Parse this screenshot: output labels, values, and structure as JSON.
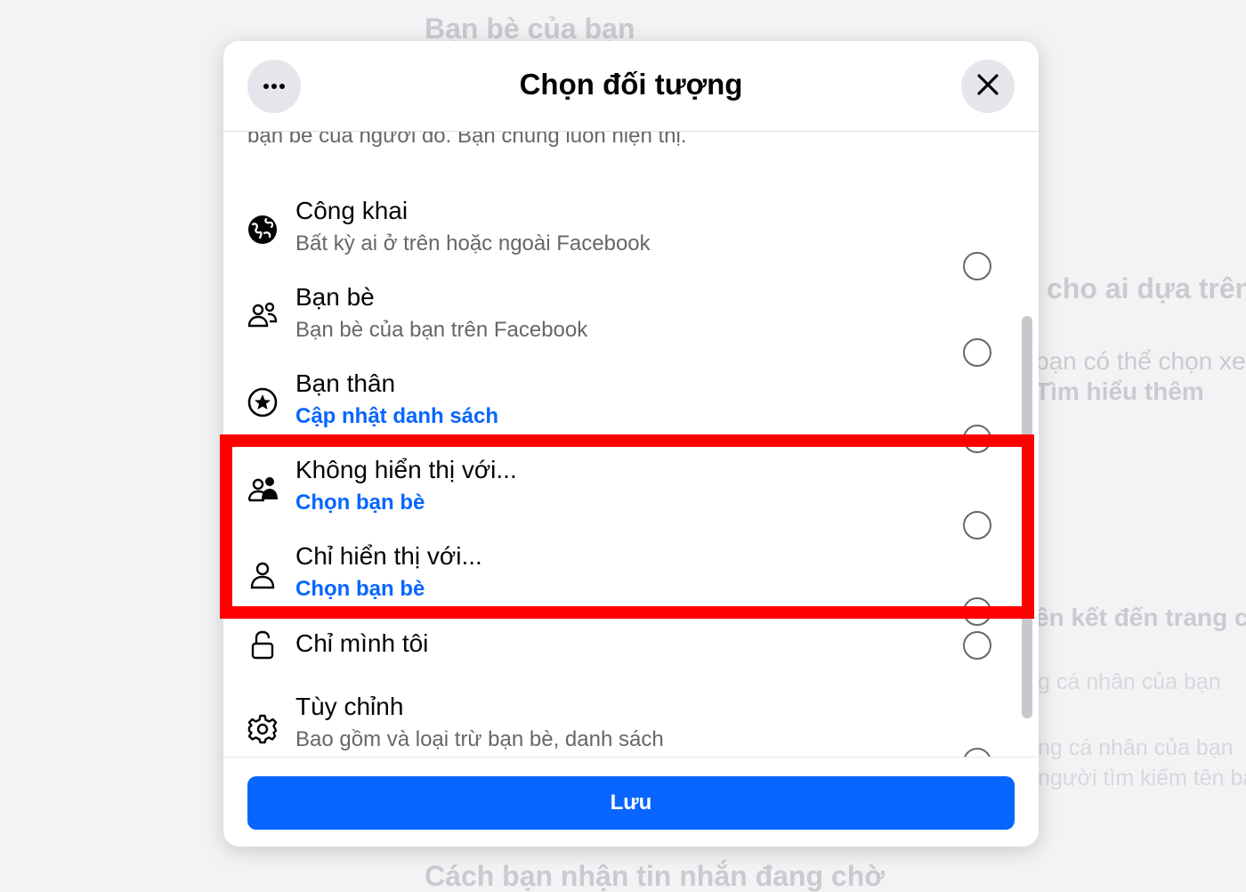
{
  "background": {
    "heading_top": "Bạn bè của bạn",
    "right_heading": "cho ai dựa trên",
    "right_text_1": "bạn có thể chọn xe",
    "right_link": "Tìm hiểu thêm",
    "right_heading_2": "ên kết đến trang cá",
    "right_text_2": "g cá nhân của bạn",
    "right_text_3": "ng cá nhân của bạn",
    "right_text_4": "người tìm kiếm tên ba",
    "heading_bottom": "Cách bạn nhận tin nhắn đang chờ"
  },
  "dialog": {
    "title": "Chọn đối tượng",
    "more_icon": "more-horizontal-icon",
    "close_icon": "close-icon",
    "clipped_description": "bạn bè của người đó. Bạn chúng luôn hiện thị.",
    "options": [
      {
        "title": "Công khai",
        "subtitle": "Bất kỳ ai ở trên hoặc ngoài Facebook",
        "icon": "globe-icon",
        "selected": false
      },
      {
        "title": "Bạn bè",
        "subtitle": "Bạn bè của bạn trên Facebook",
        "icon": "friends-icon",
        "selected": false
      },
      {
        "title": "Bạn thân",
        "subtitle": "Cập nhật danh sách",
        "icon": "star-circle-icon",
        "selected": false
      },
      {
        "title": "Không hiển thị với...",
        "subtitle": "Chọn bạn bè",
        "icon": "friends-except-icon",
        "selected": false
      },
      {
        "title": "Chỉ hiển thị với...",
        "subtitle": "Chọn bạn bè",
        "icon": "person-icon",
        "selected": false
      },
      {
        "title": "Chỉ mình tôi",
        "subtitle": "",
        "icon": "lock-icon",
        "selected": false
      },
      {
        "title": "Tùy chỉnh",
        "subtitle": "Bao gồm và loại trừ bạn bè, danh sách",
        "icon": "gear-icon",
        "selected": false
      }
    ],
    "save_label": "Lưu"
  },
  "colors": {
    "accent": "#0866ff",
    "highlight": "#ff0000",
    "secondary_text": "#65676b"
  }
}
